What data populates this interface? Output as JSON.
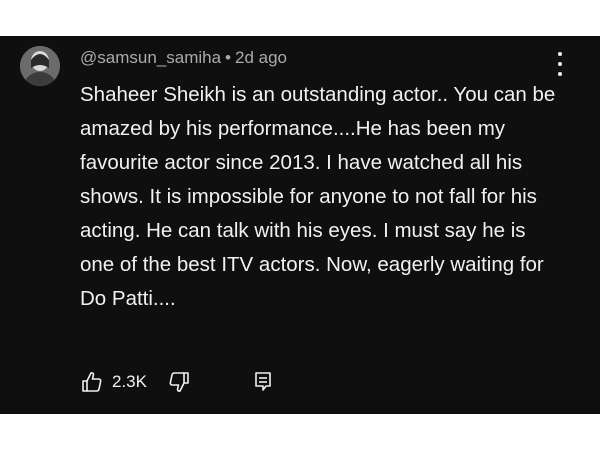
{
  "comment": {
    "author": "@samsun_samiha",
    "separator": "•",
    "time": "2d ago",
    "text": "Shaheer Sheikh is an outstanding actor.. You can be amazed by his performance....He has been my favourite actor since 2013. I have watched all his shows. It is impossible for anyone to not fall for his acting. He can talk with his eyes. I must say he is one of the best ITV actors. Now, eagerly waiting for Do Patti....",
    "likes": "2.3K"
  },
  "icons": {
    "avatar": "avatar",
    "more": "more-vertical-icon",
    "like": "thumbs-up-icon",
    "dislike": "thumbs-down-icon",
    "reply": "reply-comment-icon"
  },
  "colors": {
    "background": "#0f0f0f",
    "text": "#f1f1f1",
    "meta": "#aaaaaa"
  }
}
